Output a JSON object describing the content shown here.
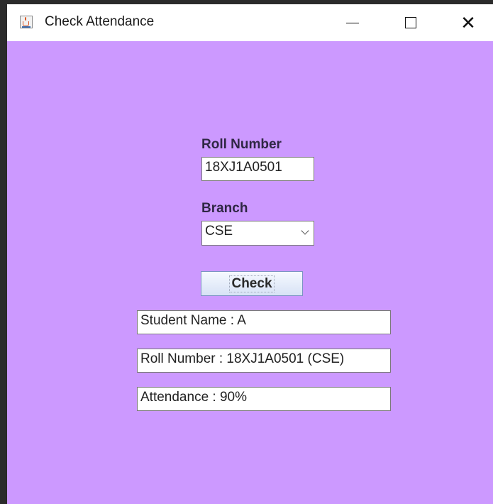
{
  "window": {
    "title": "Check Attendance",
    "icon": "java-cup-icon"
  },
  "titlebar_controls": [
    "minimize-icon",
    "maximize-icon",
    "close-icon"
  ],
  "form": {
    "roll_label": "Roll Number",
    "roll_value": "18XJ1A0501",
    "branch_label": "Branch",
    "branch_selected": "CSE",
    "check_label": "Check"
  },
  "results": {
    "student_name": "Student Name : A",
    "roll_number": "Roll Number : 18XJ1A0501 (CSE)",
    "attendance": "Attendance : 90%"
  },
  "colors": {
    "background": "#cc99ff",
    "titlebar": "#ffffff"
  }
}
